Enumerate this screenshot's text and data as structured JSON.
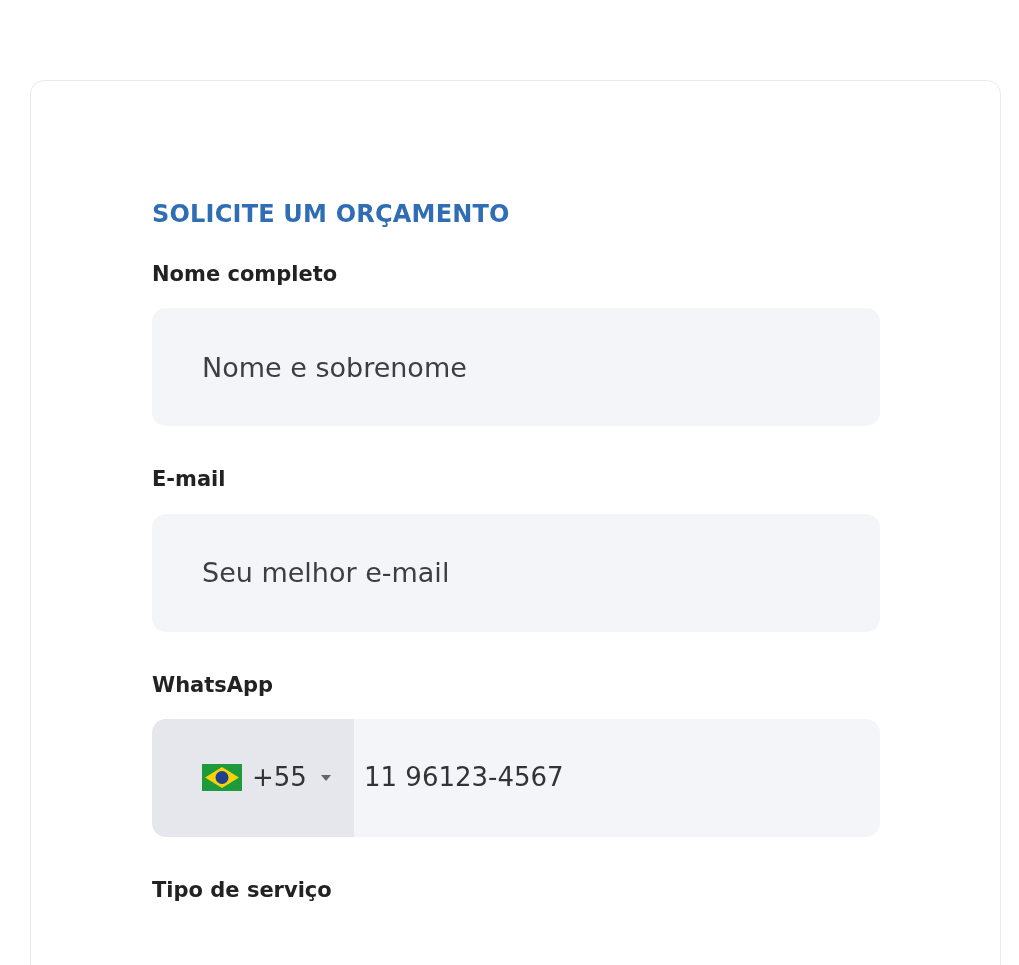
{
  "form": {
    "title": "SOLICITE UM ORÇAMENTO",
    "fields": [
      {
        "kind": "text",
        "label": "Nome completo",
        "placeholder": "Nome e sobrenome"
      },
      {
        "kind": "text",
        "label": "E-mail",
        "placeholder": "Seu melhor e-mail"
      },
      {
        "kind": "phone",
        "label": "WhatsApp",
        "country_code": "+55",
        "value": "11 96123-4567"
      },
      {
        "kind": "label_only",
        "label": "Tipo de serviço"
      }
    ]
  }
}
